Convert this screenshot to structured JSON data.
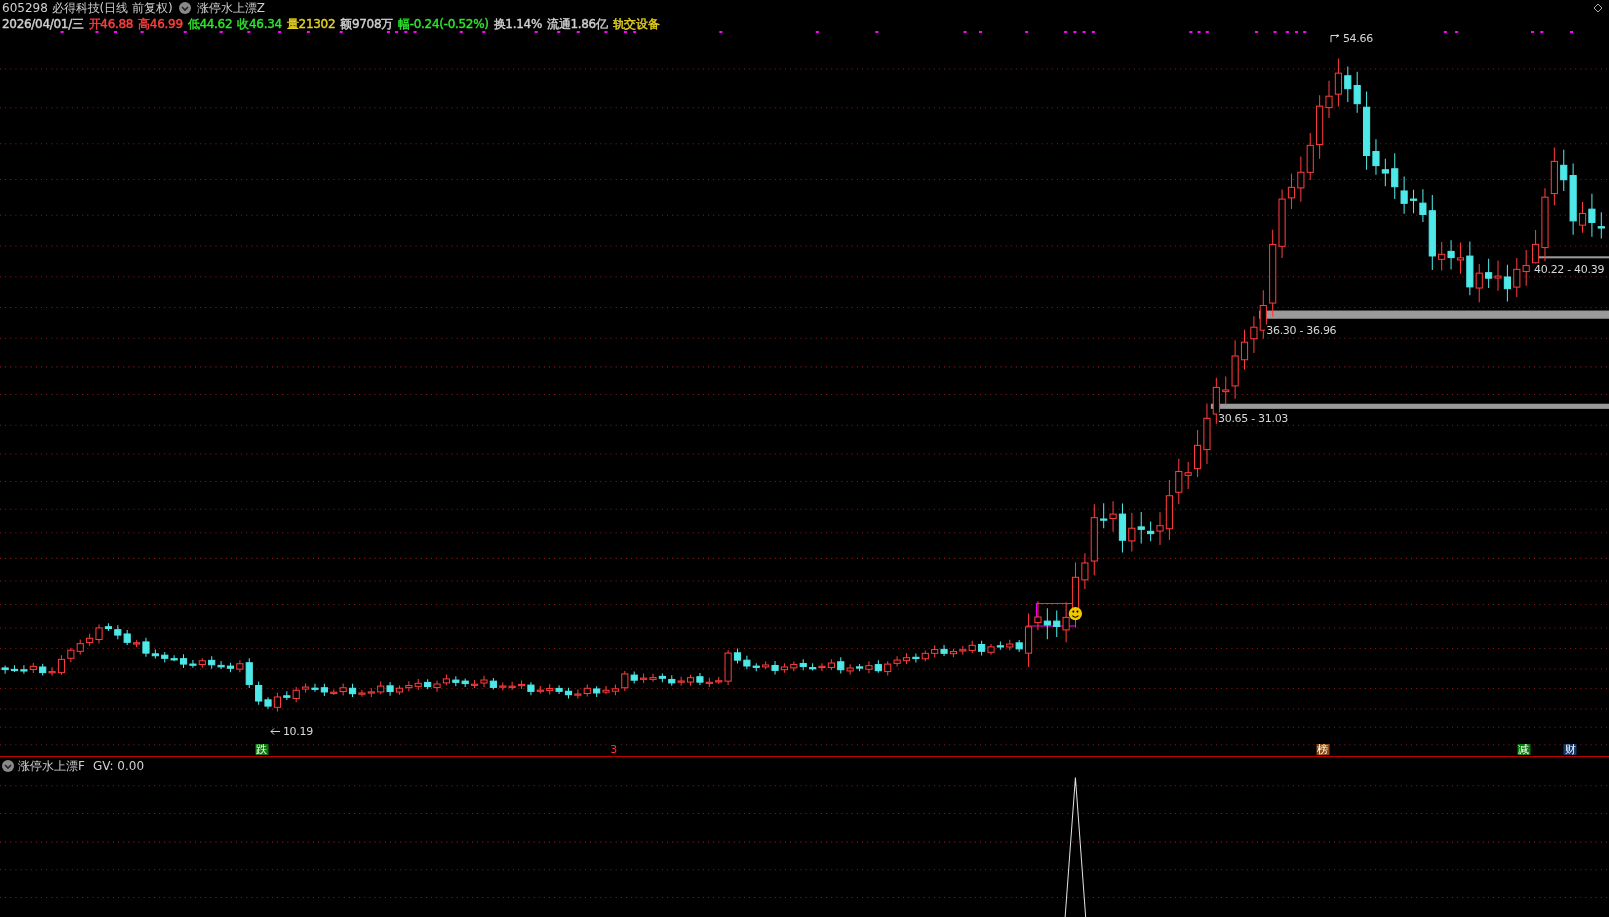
{
  "header": {
    "title": "605298 必得科技(日线 前复权)",
    "indicator": "涨停水上漂Z"
  },
  "quote": [
    {
      "text": "2026/04/01/三",
      "color": "#d0d0d0"
    },
    {
      "text": "开46.88",
      "color": "#ff4040"
    },
    {
      "text": "高46.99",
      "color": "#ff4040"
    },
    {
      "text": "低44.62",
      "color": "#2ee62e"
    },
    {
      "text": "收46.34",
      "color": "#2ee62e"
    },
    {
      "text": "量21302",
      "color": "#e6d21e"
    },
    {
      "text": "额9708万",
      "color": "#d0d0d0"
    },
    {
      "text": "幅-0.24(-0.52%)",
      "color": "#2ee62e"
    },
    {
      "text": "换1.14%",
      "color": "#d0d0d0"
    },
    {
      "text": "流通1.86亿",
      "color": "#d0d0d0"
    },
    {
      "text": "轨交设备",
      "color": "#e6d21e"
    }
  ],
  "price_labels": [
    {
      "text": "54.66",
      "kind": "high"
    },
    {
      "text": "10.19",
      "kind": "low"
    },
    {
      "text": "40.22 - 40.39",
      "kind": "band"
    },
    {
      "text": "36.30 - 36.96",
      "kind": "band"
    },
    {
      "text": "30.65 - 31.03",
      "kind": "band"
    }
  ],
  "markers": [
    {
      "text": "跌",
      "color": "#0a7a0a"
    },
    {
      "text": "3",
      "color": "#000000"
    },
    {
      "text": "榜",
      "color": "#8a4a10"
    },
    {
      "text": "减",
      "color": "#0a7a0a"
    },
    {
      "text": "财",
      "color": "#123a6a"
    }
  ],
  "sub_panel": {
    "title": "涨停水上漂F",
    "value": "GV: 0.00"
  }
}
